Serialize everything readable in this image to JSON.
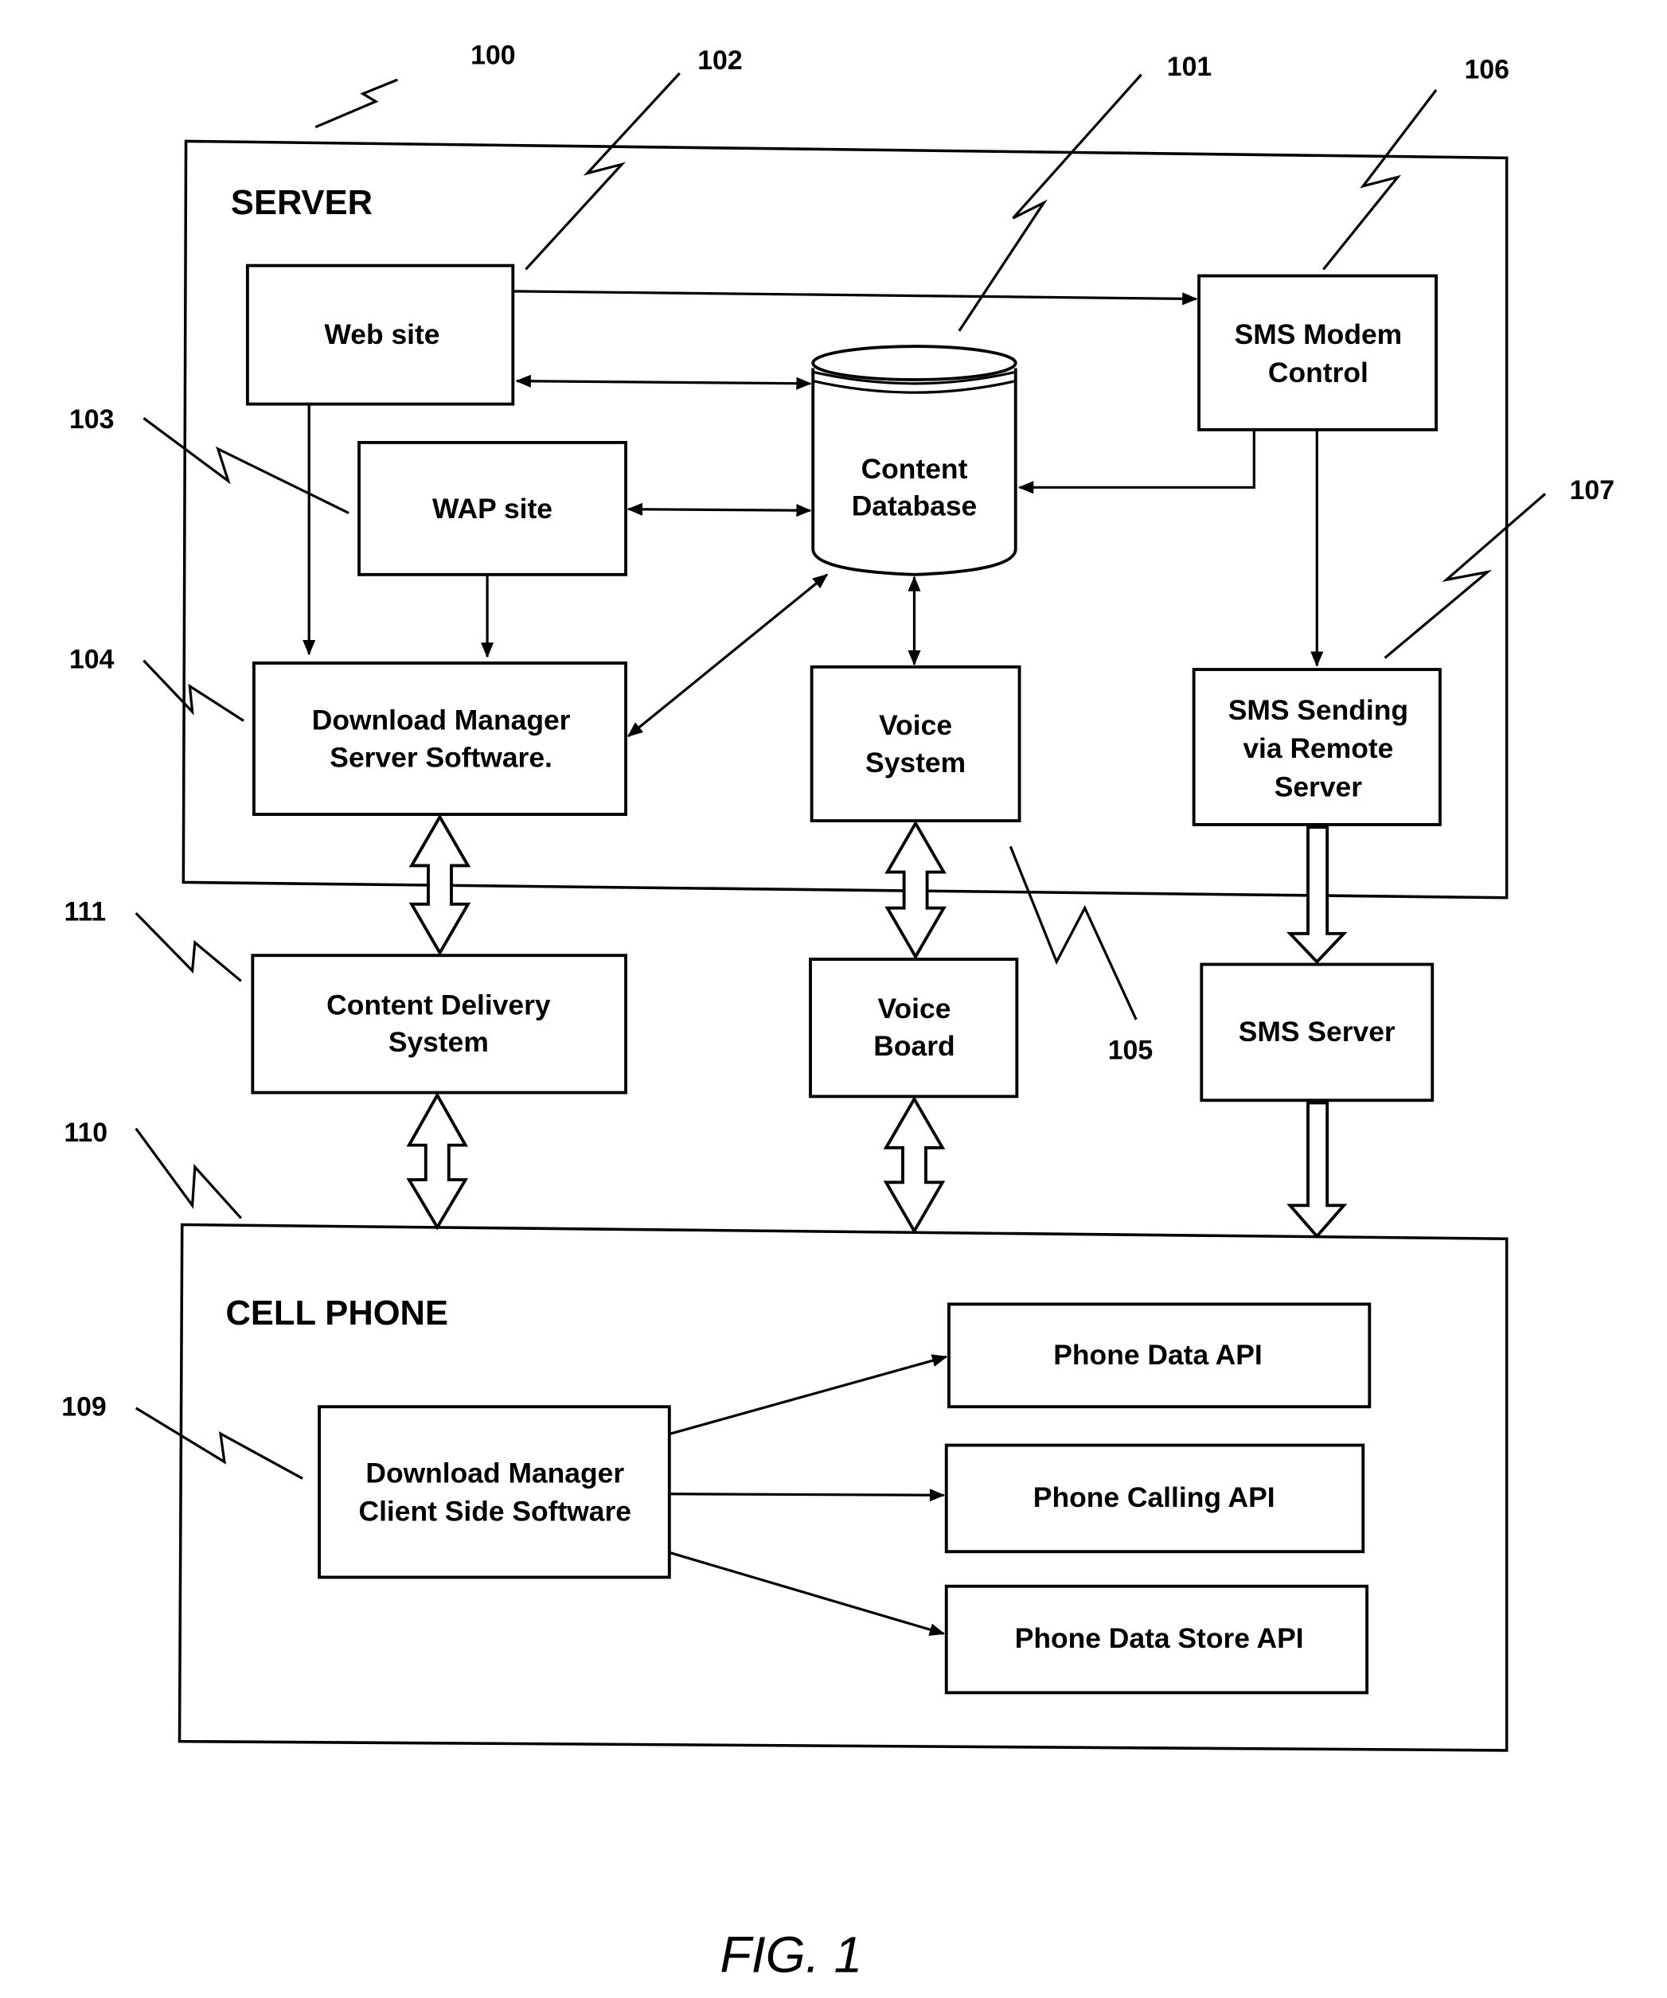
{
  "figure": {
    "caption": "FIG. 1",
    "server": {
      "title": "SERVER",
      "ref": "100",
      "components": {
        "web_site": {
          "ref": "102",
          "lines": [
            "Web site"
          ]
        },
        "content_database": {
          "ref": "101",
          "lines": [
            "Content",
            "Database"
          ]
        },
        "wap_site": {
          "ref": "103",
          "lines": [
            "WAP site"
          ]
        },
        "sms_modem_control": {
          "ref": "106",
          "lines": [
            "SMS Modem",
            "Control"
          ]
        },
        "download_manager_server": {
          "ref": "104",
          "lines": [
            "Download Manager",
            "Server Software."
          ]
        },
        "voice_system": {
          "ref": "105",
          "lines": [
            "Voice",
            "System"
          ]
        },
        "sms_sending": {
          "ref": "107",
          "lines": [
            "SMS Sending",
            "via Remote",
            "Server"
          ]
        }
      }
    },
    "intermediate": {
      "content_delivery_system": {
        "ref": "111",
        "lines": [
          "Content Delivery",
          "System"
        ]
      },
      "voice_board": {
        "lines": [
          "Voice",
          "Board"
        ]
      },
      "sms_server": {
        "lines": [
          "SMS Server"
        ]
      }
    },
    "cell_phone": {
      "title": "CELL PHONE",
      "ref": "110",
      "components": {
        "download_manager_client": {
          "ref": "109",
          "lines": [
            "Download Manager",
            "Client Side Software"
          ]
        },
        "phone_data_api": {
          "lines": [
            "Phone Data API"
          ]
        },
        "phone_calling_api": {
          "lines": [
            "Phone Calling API"
          ]
        },
        "phone_data_store_api": {
          "lines": [
            "Phone Data Store API"
          ]
        }
      }
    },
    "connections": [
      {
        "from": "Web site",
        "to": "SMS Modem Control",
        "type": "arrow"
      },
      {
        "from": "Web site",
        "to": "Content Database",
        "type": "bidirectional"
      },
      {
        "from": "WAP site",
        "to": "Content Database",
        "type": "bidirectional"
      },
      {
        "from": "SMS Modem Control",
        "to": "Content Database",
        "type": "arrow"
      },
      {
        "from": "Web site",
        "to": "Download Manager Server Software.",
        "type": "arrow"
      },
      {
        "from": "WAP site",
        "to": "Download Manager Server Software.",
        "type": "arrow"
      },
      {
        "from": "Content Database",
        "to": "Download Manager Server Software.",
        "type": "bidirectional"
      },
      {
        "from": "Content Database",
        "to": "Voice System",
        "type": "bidirectional"
      },
      {
        "from": "SMS Modem Control",
        "to": "SMS Sending via Remote Server",
        "type": "arrow"
      },
      {
        "from": "Download Manager Server Software.",
        "to": "Content Delivery System",
        "type": "wide-bidirectional"
      },
      {
        "from": "Voice System",
        "to": "Voice Board",
        "type": "wide-bidirectional"
      },
      {
        "from": "SMS Sending via Remote Server",
        "to": "SMS Server",
        "type": "wide-arrow"
      },
      {
        "from": "Content Delivery System",
        "to": "CELL PHONE",
        "type": "wide-bidirectional"
      },
      {
        "from": "Voice Board",
        "to": "CELL PHONE",
        "type": "wide-bidirectional"
      },
      {
        "from": "SMS Server",
        "to": "CELL PHONE",
        "type": "wide-arrow"
      },
      {
        "from": "Download Manager Client Side Software",
        "to": "Phone Data API",
        "type": "arrow"
      },
      {
        "from": "Download Manager Client Side Software",
        "to": "Phone Calling API",
        "type": "arrow"
      },
      {
        "from": "Download Manager Client Side Software",
        "to": "Phone Data Store API",
        "type": "arrow"
      }
    ]
  }
}
